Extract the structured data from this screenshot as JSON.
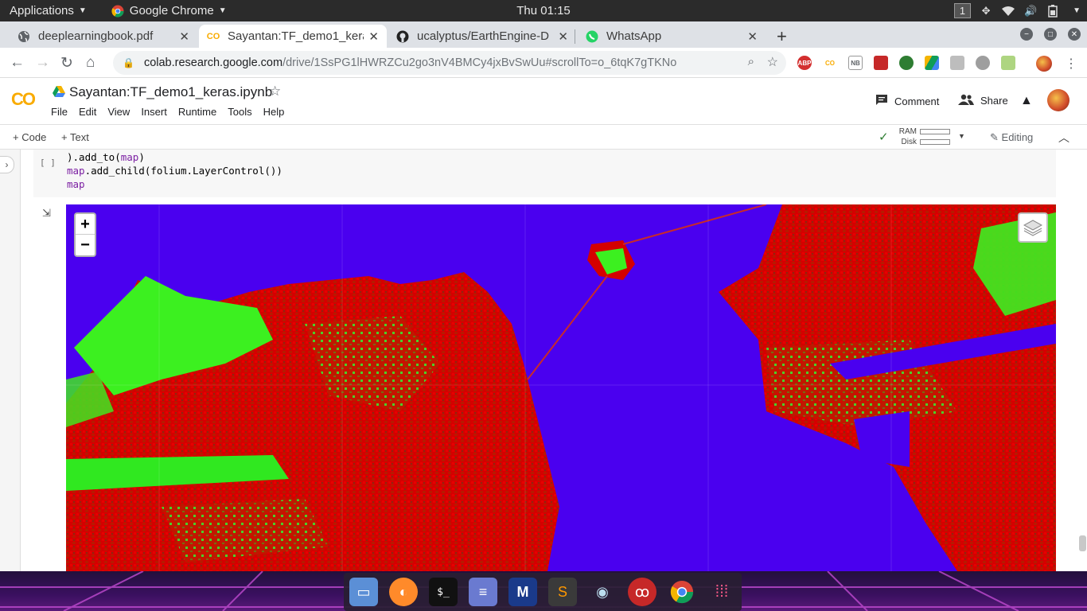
{
  "system": {
    "applications_label": "Applications",
    "active_app_label": "Google Chrome",
    "clock": "Thu 01:15",
    "workspace": "1"
  },
  "tabs": [
    {
      "title": "deeplearningbook.pdf",
      "icon": "globe-icon"
    },
    {
      "title": "Sayantan:TF_demo1_kera",
      "icon": "colab-icon"
    },
    {
      "title": "ucalyptus/EarthEngine-D",
      "icon": "github-icon"
    },
    {
      "title": "WhatsApp",
      "icon": "whatsapp-icon"
    }
  ],
  "address": {
    "host": "colab.research.google.com",
    "path": "/drive/1SsPG1lHWRZCu2go3nV4BMCy4jxBvSwUu#scrollTo=o_6tqK7gTKNo"
  },
  "extensions": [
    "ABP",
    "CO",
    "NB"
  ],
  "colab": {
    "logo": "CO",
    "notebook_title": "Sayantan:TF_demo1_keras.ipynb",
    "menu": [
      "File",
      "Edit",
      "View",
      "Insert",
      "Runtime",
      "Tools",
      "Help"
    ],
    "comment_label": "Comment",
    "share_label": "Share",
    "add_code_label": "Code",
    "add_text_label": "Text",
    "ram_label": "RAM",
    "disk_label": "Disk",
    "ram_usage": 0.0,
    "disk_usage": 0.0,
    "editing_label": "Editing"
  },
  "cell": {
    "run_indicator": "[ ]",
    "lines": [
      {
        "pre": ").add_to(",
        "kw": "map",
        "post": ")"
      },
      {
        "pre": "",
        "kw": "map",
        "post": ".add_child(folium.LayerControl())"
      },
      {
        "pre": "",
        "kw": "map",
        "post": ""
      }
    ]
  },
  "map": {
    "zoom_in": "+",
    "zoom_out": "−",
    "colors": {
      "water": "#4a00ef",
      "urban": "#d40000",
      "vegetation": "#22ee10"
    }
  },
  "dock": {
    "apps": [
      "files-icon",
      "firefox-icon",
      "terminal-icon",
      "text-editor-icon",
      "malwarebytes-icon",
      "sublime-icon",
      "eye-icon",
      "cherry-icon",
      "chrome-icon",
      "app-grid-icon"
    ]
  }
}
